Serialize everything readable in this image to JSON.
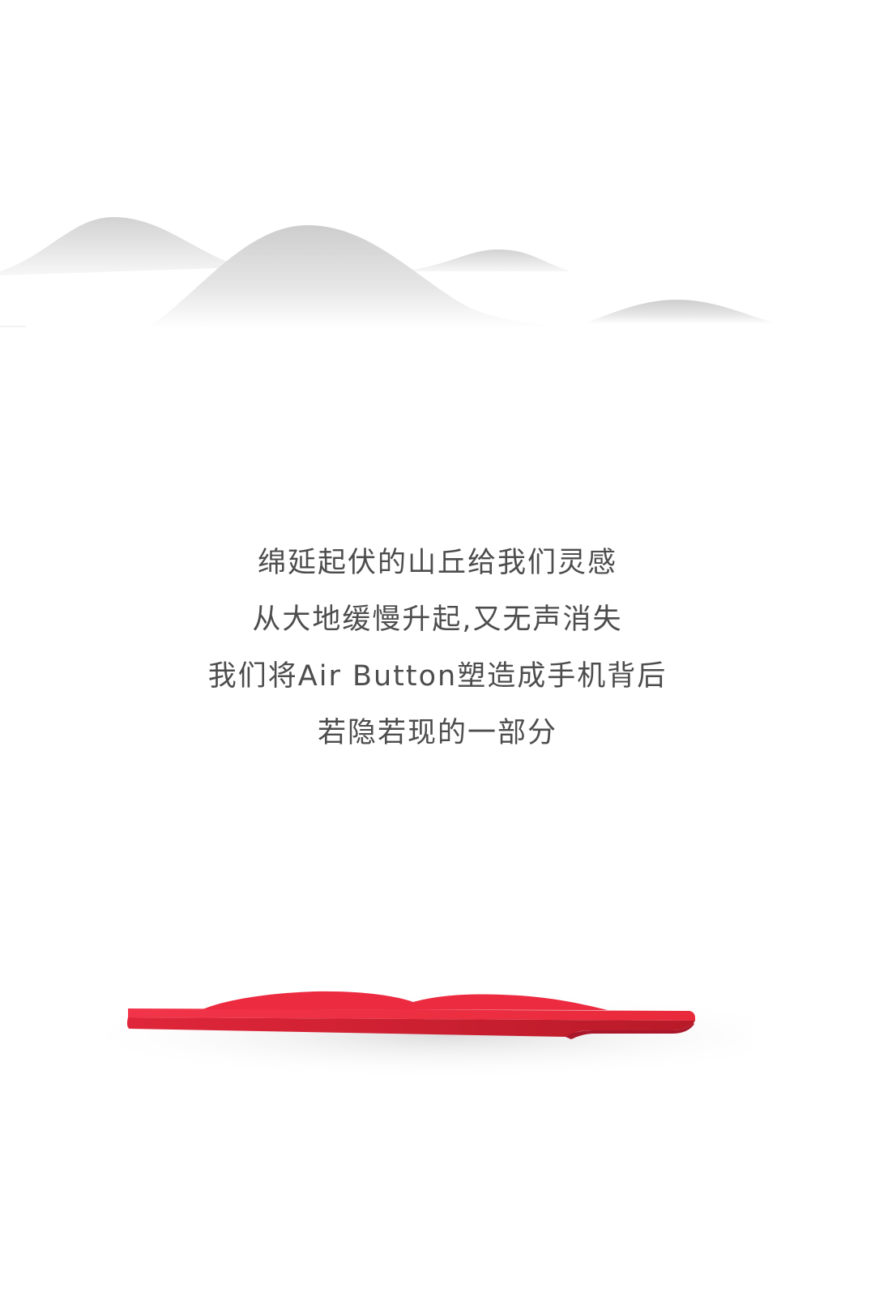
{
  "artwork": {
    "hills_colors": {
      "top": "#cdcdcd",
      "fade": "#ffffff"
    },
    "product_colors": {
      "face": "#ef2b3d",
      "edge": "#c21d2b",
      "shadow": "#d9d9d9"
    }
  },
  "copy": {
    "line1": "绵延起伏的山丘给我们灵感",
    "line2": "从大地缓慢升起,又无声消失",
    "line3": "我们将Air Button塑造成手机背后",
    "line4": "若隐若现的一部分"
  }
}
